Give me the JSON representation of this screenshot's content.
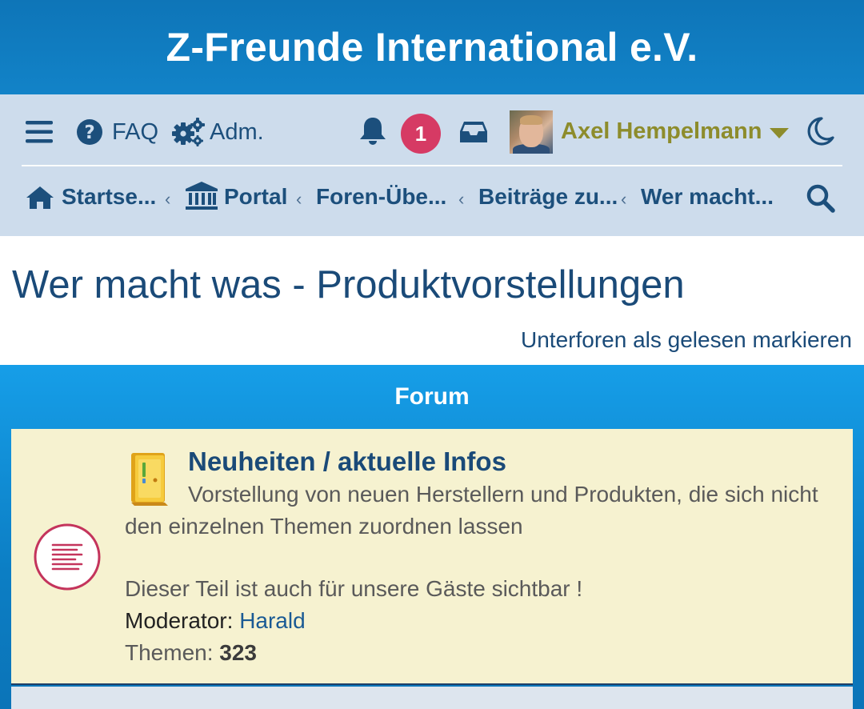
{
  "site": {
    "title": "Z-Freunde International e.V."
  },
  "nav": {
    "faq_label": "FAQ",
    "admin_label": "Adm.",
    "notifications_count": "1",
    "user": {
      "name": "Axel Hempelmann"
    },
    "icons": [
      "menu-icon",
      "help-icon",
      "gears-icon",
      "bell-icon",
      "inbox-icon",
      "chevron-down-icon",
      "moon-icon",
      "home-icon",
      "bank-icon",
      "search-icon"
    ],
    "username_color": "#8d8c2c",
    "badge_color": "#d63a64"
  },
  "breadcrumbs": [
    "Startse...",
    "Portal",
    "Foren-Übe...",
    "Beiträge zu...",
    "Wer macht..."
  ],
  "page": {
    "title": "Wer macht was - Produktvorstellungen",
    "mark_read": "Unterforen als gelesen markieren"
  },
  "forum_section": {
    "header": "Forum",
    "forums": [
      {
        "title": "Neuheiten / aktuelle Infos",
        "description": "Vorstellung von neuen Herstellern und Produkten, die sich nicht den einzelnen Themen zuordnen lassen",
        "note": "Dieser Teil ist auch für unsere Gäste sichtbar !",
        "moderator_label": "Moderator:",
        "moderator": "Harald",
        "topics_label": "Themen:",
        "topics": "323"
      }
    ]
  }
}
